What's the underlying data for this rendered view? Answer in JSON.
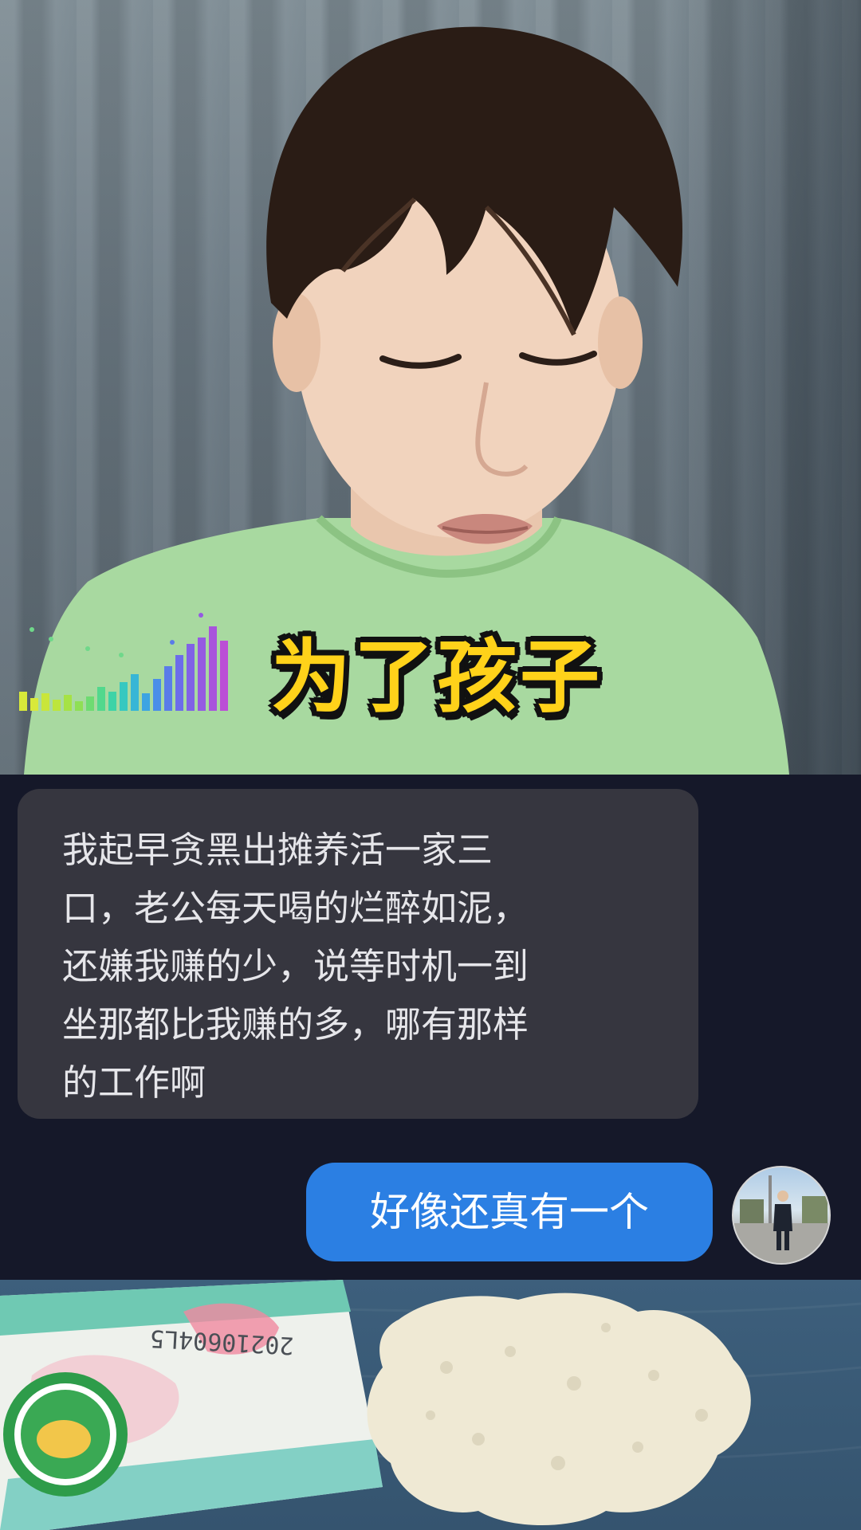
{
  "video_top": {
    "subtitle": "为了孩子"
  },
  "chat": {
    "incoming_message": {
      "lines": [
        "我起早贪黑出摊养活一家三",
        "口，老公每天喝的烂醉如泥，",
        "还嫌我赚的少，说等时机一到",
        "坐那都比我赚的多，哪有那样",
        "的工作啊"
      ]
    },
    "outgoing_message": {
      "text": "好像还真有一个"
    }
  },
  "video_bottom": {
    "package_date_code": "20210604L5"
  },
  "colors": {
    "subtitle_yellow": "#ffd21a",
    "incoming_bubble": "#36363f",
    "outgoing_bubble": "#2b7fe3",
    "chat_background": "#151829"
  }
}
